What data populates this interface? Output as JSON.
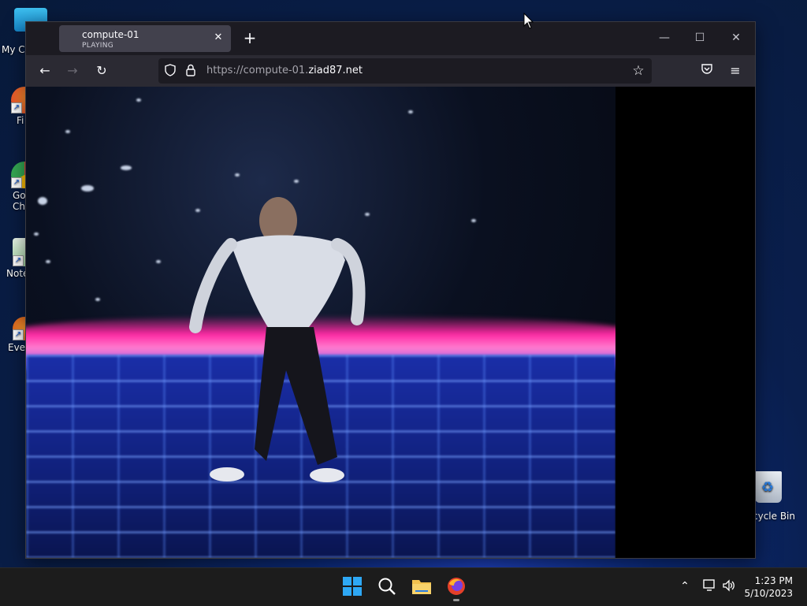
{
  "desktop": {
    "icons": [
      {
        "label": "My C"
      },
      {
        "label": "Fi"
      },
      {
        "label": "Go Ch"
      },
      {
        "label": "Note"
      },
      {
        "label": "Ever"
      }
    ],
    "recycle_bin": {
      "label": "cycle Bin"
    }
  },
  "browser": {
    "tab": {
      "title": "compute-01",
      "status": "PLAYING"
    },
    "url": {
      "prefix": "https://compute-01.",
      "host": "ziad87.net"
    }
  },
  "taskbar": {
    "clock": {
      "time": "1:23 PM",
      "date": "5/10/2023"
    }
  },
  "colors": {
    "accent_pink": "#ff2aa4",
    "floor_blue": "#1a2ea8",
    "browser_chrome": "#1c1b22"
  }
}
